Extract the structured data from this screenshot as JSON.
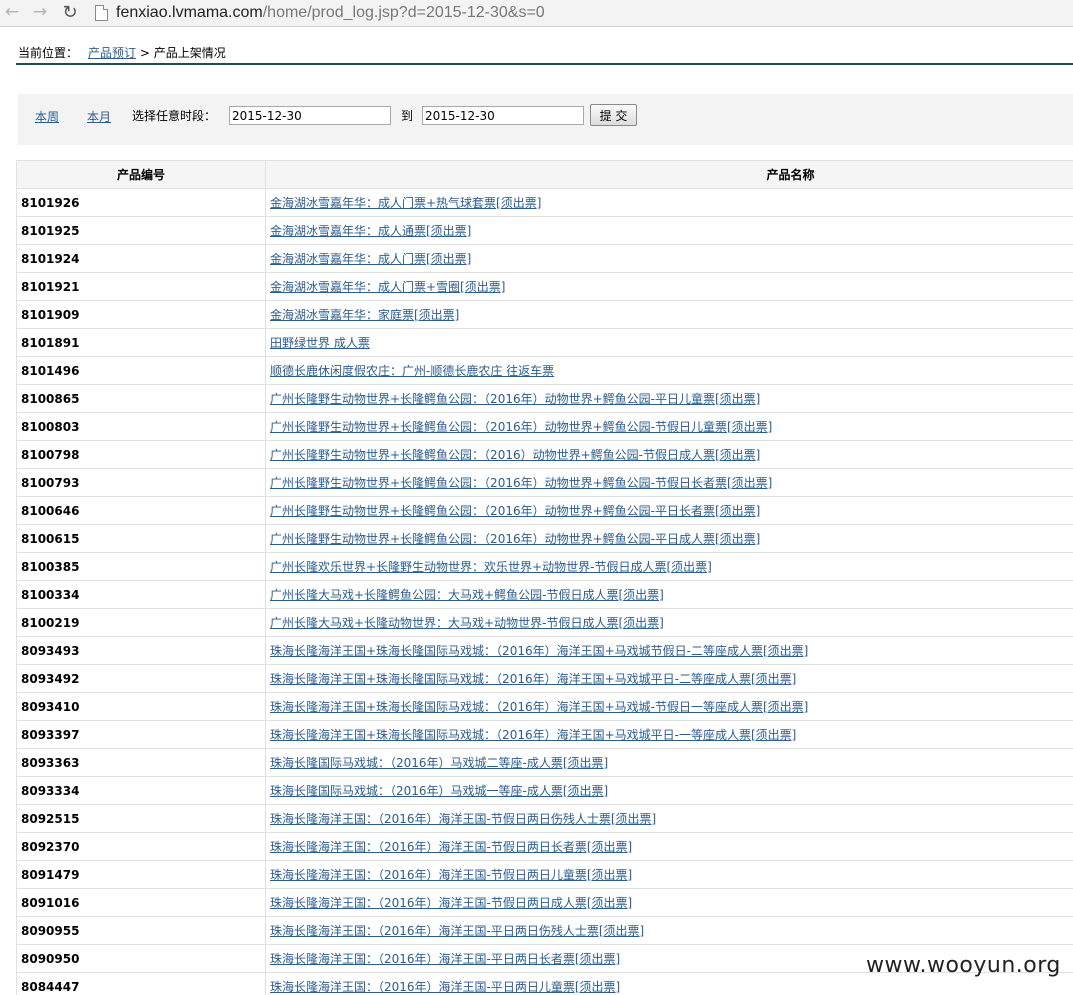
{
  "browser": {
    "url_host": "fenxiao.lvmama.com",
    "url_path": "/home/prod_log.jsp?d=2015-12-30&s=0"
  },
  "breadcrumb": {
    "label": "当前位置：",
    "link": "产品预订",
    "sep": " > ",
    "current": "产品上架情况"
  },
  "filter": {
    "this_week": "本周",
    "this_month": "本月",
    "range_label": "选择任意时段：",
    "start_date": "2015-12-30",
    "to_label": "到",
    "end_date": "2015-12-30",
    "submit_label": "提 交"
  },
  "table": {
    "headers": [
      "产品编号",
      "产品名称"
    ],
    "rows": [
      {
        "code": "8101926",
        "name": "金海湖冰雪嘉年华：成人门票+热气球套票[须出票]"
      },
      {
        "code": "8101925",
        "name": "金海湖冰雪嘉年华：成人通票[须出票]"
      },
      {
        "code": "8101924",
        "name": "金海湖冰雪嘉年华：成人门票[须出票]"
      },
      {
        "code": "8101921",
        "name": "金海湖冰雪嘉年华：成人门票+雪圈[须出票]"
      },
      {
        "code": "8101909",
        "name": "金海湖冰雪嘉年华：家庭票[须出票]"
      },
      {
        "code": "8101891",
        "name": "田野绿世界 成人票"
      },
      {
        "code": "8101496",
        "name": "顺德长鹿休闲度假农庄：广州-顺德长鹿农庄 往返车票"
      },
      {
        "code": "8100865",
        "name": "广州长隆野生动物世界+长隆鳄鱼公园：（2016年）动物世界+鳄鱼公园-平日儿童票[须出票]"
      },
      {
        "code": "8100803",
        "name": "广州长隆野生动物世界+长隆鳄鱼公园：（2016年）动物世界+鳄鱼公园-节假日儿童票[须出票]"
      },
      {
        "code": "8100798",
        "name": "广州长隆野生动物世界+长隆鳄鱼公园：（2016）动物世界+鳄鱼公园-节假日成人票[须出票]"
      },
      {
        "code": "8100793",
        "name": "广州长隆野生动物世界+长隆鳄鱼公园：（2016年）动物世界+鳄鱼公园-节假日长者票[须出票]"
      },
      {
        "code": "8100646",
        "name": "广州长隆野生动物世界+长隆鳄鱼公园：（2016年）动物世界+鳄鱼公园-平日长者票[须出票]"
      },
      {
        "code": "8100615",
        "name": "广州长隆野生动物世界+长隆鳄鱼公园：（2016年）动物世界+鳄鱼公园-平日成人票[须出票]"
      },
      {
        "code": "8100385",
        "name": "广州长隆欢乐世界+长隆野生动物世界：欢乐世界+动物世界-节假日成人票[须出票]"
      },
      {
        "code": "8100334",
        "name": "广州长隆大马戏+长隆鳄鱼公园：大马戏+鳄鱼公园-节假日成人票[须出票]"
      },
      {
        "code": "8100219",
        "name": "广州长隆大马戏+长隆动物世界：大马戏+动物世界-节假日成人票[须出票]"
      },
      {
        "code": "8093493",
        "name": "珠海长隆海洋王国+珠海长隆国际马戏城：（2016年）海洋王国+马戏城节假日-二等座成人票[须出票]"
      },
      {
        "code": "8093492",
        "name": "珠海长隆海洋王国+珠海长隆国际马戏城：（2016年）海洋王国+马戏城平日-二等座成人票[须出票]"
      },
      {
        "code": "8093410",
        "name": "珠海长隆海洋王国+珠海长隆国际马戏城：（2016年）海洋王国+马戏城-节假日一等座成人票[须出票]"
      },
      {
        "code": "8093397",
        "name": "珠海长隆海洋王国+珠海长隆国际马戏城：（2016年）海洋王国+马戏城平日-一等座成人票[须出票]"
      },
      {
        "code": "8093363",
        "name": "珠海长隆国际马戏城：（2016年）马戏城二等座-成人票[须出票]"
      },
      {
        "code": "8093334",
        "name": "珠海长隆国际马戏城：（2016年）马戏城一等座-成人票[须出票]"
      },
      {
        "code": "8092515",
        "name": "珠海长隆海洋王国：（2016年）海洋王国-节假日两日伤残人士票[须出票]"
      },
      {
        "code": "8092370",
        "name": "珠海长隆海洋王国：（2016年）海洋王国-节假日两日长者票[须出票]"
      },
      {
        "code": "8091479",
        "name": "珠海长隆海洋王国：（2016年）海洋王国-节假日两日儿童票[须出票]"
      },
      {
        "code": "8091016",
        "name": "珠海长隆海洋王国：（2016年）海洋王国-节假日两日成人票[须出票]"
      },
      {
        "code": "8090955",
        "name": "珠海长隆海洋王国：（2016年）海洋王国-平日两日伤残人士票[须出票]"
      },
      {
        "code": "8090950",
        "name": "珠海长隆海洋王国：（2016年）海洋王国-平日两日长者票[须出票]"
      },
      {
        "code": "8084447",
        "name": "珠海长隆海洋王国：（2016年）海洋王国-平日两日儿童票[须出票]"
      }
    ]
  },
  "watermark": "www.wooyun.org"
}
